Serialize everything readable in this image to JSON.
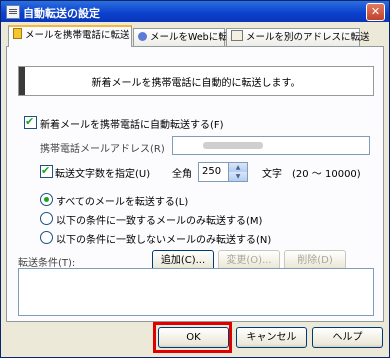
{
  "window": {
    "title": "自動転送の設定",
    "close_glyph": "✕"
  },
  "tabs": [
    {
      "label": "メールを携帯電話に転送",
      "icon": "mobile-phone-icon"
    },
    {
      "label": "メールをWebに転送",
      "icon": "web-globe-icon"
    },
    {
      "label": "メールを別のアドレスに転送",
      "icon": "envelope-icon"
    }
  ],
  "banner": {
    "text": "新着メールを携帯電話に自動的に転送します。"
  },
  "options": {
    "auto_forward_label": "新着メールを携帯電話に自動転送する(F)",
    "mobile_address_label": "携帯電話メールアドレス(R)",
    "limit_chars_label": "転送文字数を指定(U)",
    "total_label": "全角",
    "char_count_value": "250",
    "chars_unit_label": "文字　(20 ～ 10000)"
  },
  "radios": {
    "all": "すべてのメールを転送する(L)",
    "match": "以下の条件に一致するメールのみ転送する(M)",
    "nomatch": "以下の条件に一致しないメールのみ転送する(N)"
  },
  "conditions": {
    "label": "転送条件(T):",
    "add": "追加(C)...",
    "change": "変更(O)...",
    "delete": "削除(D)"
  },
  "footer": {
    "ok": "OK",
    "cancel": "キャンセル",
    "help": "ヘルプ"
  },
  "colors": {
    "highlight": "#e00000",
    "titlebar": "#0a3fcc"
  }
}
